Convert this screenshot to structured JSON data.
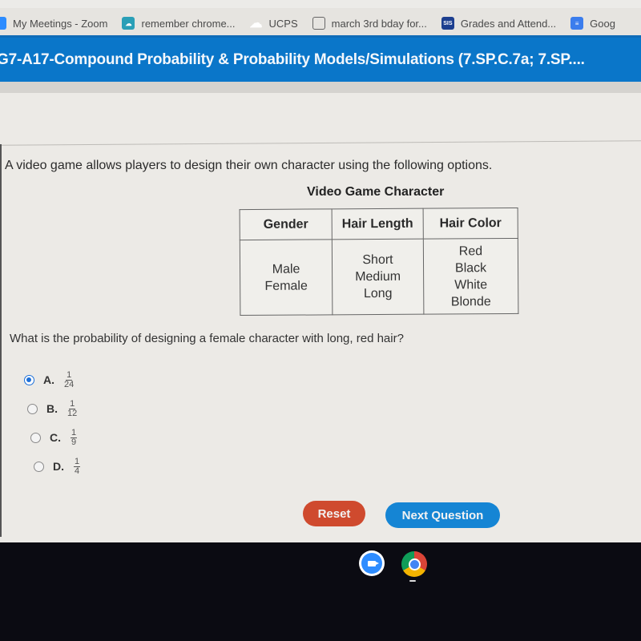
{
  "bookmarks": [
    {
      "icon": "zoom-icon",
      "label": "My Meetings - Zoom"
    },
    {
      "icon": "chrome-app-icon",
      "label": "remember chrome..."
    },
    {
      "icon": "cloud-icon",
      "label": "UCPS"
    },
    {
      "icon": "document-icon",
      "label": "march 3rd bday for..."
    },
    {
      "icon": "sis-icon",
      "icon_text": "SIS",
      "label": "Grades and Attend..."
    },
    {
      "icon": "google-docs-icon",
      "label": "Goog"
    }
  ],
  "header": {
    "title": "G7-A17-Compound Probability & Probability Models/Simulations (7.SP.C.7a; 7.SP...."
  },
  "problem": {
    "intro": "A video game allows players to design their own character using the following options.",
    "table_title": "Video Game Character",
    "table": {
      "headers": [
        "Gender",
        "Hair Length",
        "Hair Color"
      ],
      "columns": [
        [
          "Male",
          "Female"
        ],
        [
          "Short",
          "Medium",
          "Long"
        ],
        [
          "Red",
          "Black",
          "White",
          "Blonde"
        ]
      ]
    },
    "question": "What is the probability of designing a female character with long, red hair?",
    "choices": [
      {
        "letter": "A.",
        "numerator": "1",
        "denominator": "24",
        "selected": true
      },
      {
        "letter": "B.",
        "numerator": "1",
        "denominator": "12",
        "selected": false
      },
      {
        "letter": "C.",
        "numerator": "1",
        "denominator": "9",
        "selected": false
      },
      {
        "letter": "D.",
        "numerator": "1",
        "denominator": "4",
        "selected": false
      }
    ]
  },
  "buttons": {
    "reset": "Reset",
    "next": "Next Question"
  },
  "colors": {
    "header_blue": "#0a76c9",
    "reset_red": "#cf4a2e",
    "next_blue": "#1585d4",
    "radio_selected": "#1c6fd8"
  },
  "shelf": {
    "apps": [
      "Zoom",
      "Google Chrome"
    ]
  }
}
